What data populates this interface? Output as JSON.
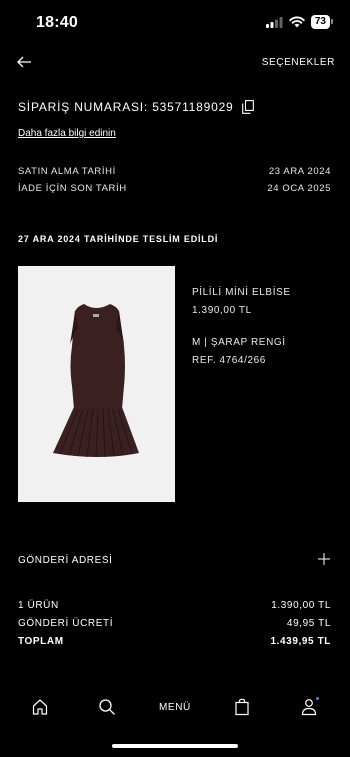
{
  "status_bar": {
    "time": "18:40",
    "battery": "73"
  },
  "header": {
    "options_label": "SEÇENEKLER"
  },
  "order": {
    "number_label": "SİPARİŞ NUMARASI: 53571189029",
    "more_info": "Daha fazla bilgi edinin",
    "purchase_date_label": "SATIN ALMA TARİHİ",
    "purchase_date": "23 ARA 2024",
    "return_deadline_label": "İADE İÇİN SON TARİH",
    "return_deadline": "24 OCA 2025",
    "delivered_text": "27 ARA 2024 TARİHİNDE TESLİM EDİLDİ"
  },
  "product": {
    "name": "PİLİLİ MİNİ ELBİSE",
    "price": "1.390,00 TL",
    "variant": "M | ŞARAP RENGİ",
    "ref": "REF. 4764/266",
    "color": "#3b2021"
  },
  "shipping": {
    "label": "GÖNDERİ ADRESİ"
  },
  "summary": {
    "items_label": "1 ÜRÜN",
    "items_value": "1.390,00 TL",
    "shipping_label": "GÖNDERİ ÜCRETİ",
    "shipping_value": "49,95 TL",
    "total_label": "TOPLAM",
    "total_value": "1.439,95 TL"
  },
  "nav": {
    "home_icon": "home-icon",
    "search_icon": "search-icon",
    "menu_label": "MENÜ",
    "cart_icon": "shopping-bag-icon",
    "profile_icon": "profile-icon"
  }
}
